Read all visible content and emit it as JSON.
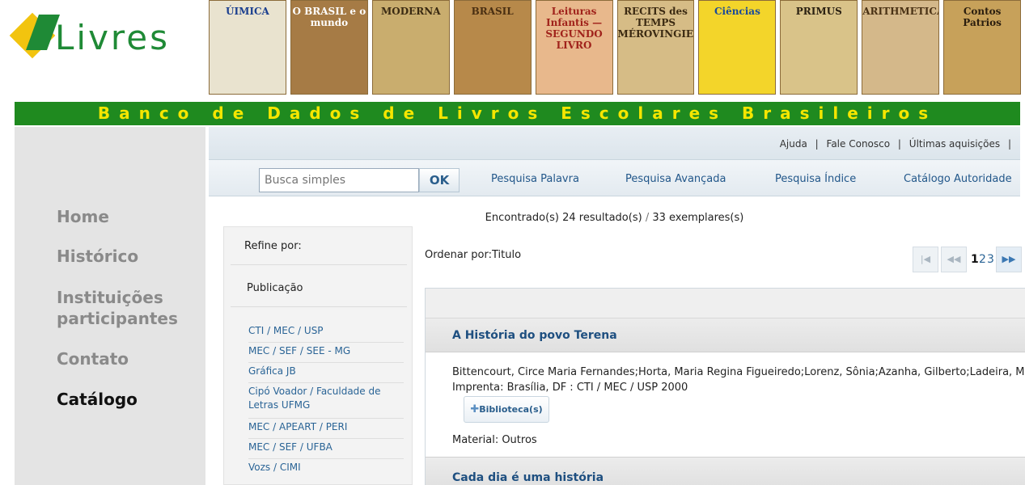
{
  "logo": {
    "text": "Livres"
  },
  "covers": [
    {
      "label": "ÚIMICA",
      "bg": "#e9e3cf",
      "fg": "#1b3f8f"
    },
    {
      "label": "O BRASIL e o mundo",
      "bg": "#a67b45",
      "fg": "#ffffff"
    },
    {
      "label": "MODERNA",
      "bg": "#c9ad6e",
      "fg": "#3a2a12"
    },
    {
      "label": "BRASIL",
      "bg": "#b7894a",
      "fg": "#4a2f12"
    },
    {
      "label": "Leituras Infantis — SEGUNDO LIVRO",
      "bg": "#e8b88c",
      "fg": "#a0221b"
    },
    {
      "label": "RECITS des TEMPS MÉROVINGIENS",
      "bg": "#d6bc86",
      "fg": "#3b2a12"
    },
    {
      "label": "Ciências",
      "bg": "#f3d52a",
      "fg": "#1a4a9a"
    },
    {
      "label": "PRIMUS",
      "bg": "#d9c389",
      "fg": "#2b2112"
    },
    {
      "label": "ARITHMETICA",
      "bg": "#d4b88a",
      "fg": "#4a3215"
    },
    {
      "label": "Contos Patrios",
      "bg": "#c7a15a",
      "fg": "#2a1d0e"
    }
  ],
  "banner": {
    "text": "Banco de Dados de Livros Escolares Brasileiros"
  },
  "nav": {
    "home": "Home",
    "historico": "Histórico",
    "instituicoes_1": "Instituições",
    "instituicoes_2": "participantes",
    "contato": "Contato",
    "catalogo": "Catálogo"
  },
  "toplinks": {
    "ajuda": "Ajuda",
    "sep1": "|",
    "fale": "Fale Conosco",
    "sep2": "|",
    "ultimas": "Últimas aquisições",
    "sep3": "|"
  },
  "search": {
    "placeholder": "Busca simples",
    "ok_label": "OK",
    "links": {
      "palavra": "Pesquisa Palavra",
      "avancada": "Pesquisa Avançada",
      "indice": "Pesquisa Índice",
      "autoridade": "Catálogo Autoridade"
    }
  },
  "results_summary": {
    "results": "Encontrado(s) 24 resultado(s)",
    "sep": "/",
    "copies": "33 exemplares(s)"
  },
  "refine": {
    "header": "Refine por:",
    "section": "Publicação",
    "facets": [
      "CTI / MEC / USP",
      "MEC / SEF / SEE - MG",
      "Gráfica JB",
      "Cipó Voador / Faculdade de Letras UFMG",
      "MEC / APEART / PERI",
      "MEC / SEF / UFBA",
      "Vozs / CIMI"
    ]
  },
  "sort": {
    "label": "Ordenar por:Titulo"
  },
  "pager": {
    "first": "|◀",
    "prev": "◀◀",
    "next": "▶▶",
    "pages": [
      "1",
      "2",
      "3"
    ]
  },
  "results": [
    {
      "title": "A História do povo Terena",
      "authors": "Bittencourt, Circe Maria Fernandes;Horta, Maria Regina Figueiredo;Lorenz, Sônia;Azanha, Gilberto;Ladeira, Maria El",
      "imprint": "Imprenta: Brasília, DF : CTI / MEC / USP 2000",
      "library_button": "Biblioteca(s)",
      "material": "Material: Outros"
    },
    {
      "title": "Cada dia é uma história"
    }
  ]
}
